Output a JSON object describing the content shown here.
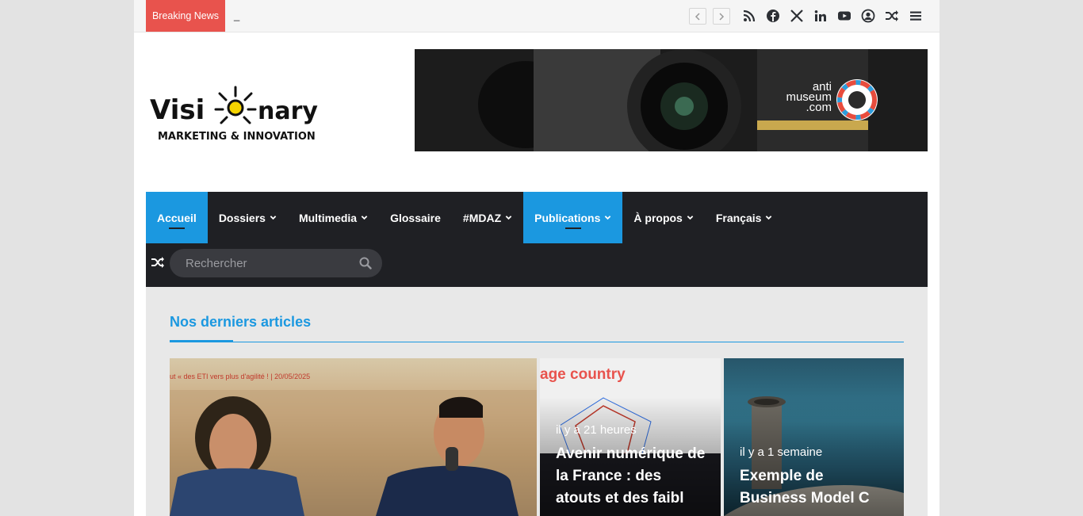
{
  "topbar": {
    "breaking_label": "Breaking News",
    "ticker_text": "_",
    "prev_label": "‹",
    "next_label": "›",
    "social_icons": [
      "rss-icon",
      "facebook-icon",
      "x-icon",
      "linkedin-icon",
      "youtube-icon",
      "user-icon",
      "shuffle-icon",
      "menu-icon"
    ]
  },
  "header": {
    "logo_text_main": "Visi-o-nary",
    "logo_text_sub": "MARKETING & INNOVATION",
    "banner_text": "anti museum .com"
  },
  "nav": {
    "items": [
      {
        "label": "Accueil",
        "dropdown": false,
        "active": true
      },
      {
        "label": "Dossiers",
        "dropdown": true,
        "active": false
      },
      {
        "label": "Multimedia",
        "dropdown": true,
        "active": false
      },
      {
        "label": "Glossaire",
        "dropdown": false,
        "active": false
      },
      {
        "label": "#MDAZ",
        "dropdown": true,
        "active": false
      },
      {
        "label": "Publications",
        "dropdown": true,
        "active": true
      },
      {
        "label": "À propos",
        "dropdown": true,
        "active": false
      },
      {
        "label": "Français",
        "dropdown": true,
        "active": false
      }
    ],
    "search_placeholder": "Rechercher"
  },
  "content": {
    "section_title": "Nos derniers articles",
    "cards": [
      {
        "date": "",
        "title": "",
        "image_text": "ut « des ETI vers plus d'agilité ! | 20/05/2025"
      },
      {
        "date": "il y a 21 heures",
        "title": "Avenir numérique de la France : des atouts et des faibl",
        "image_text": "age country"
      },
      {
        "date": "il y a 1 semaine",
        "title": "Exemple de Business Model C",
        "image_text": ""
      }
    ]
  },
  "colors": {
    "accent": "#1b98e0",
    "breaking": "#e8534d",
    "nav_bg": "#1f2024"
  }
}
